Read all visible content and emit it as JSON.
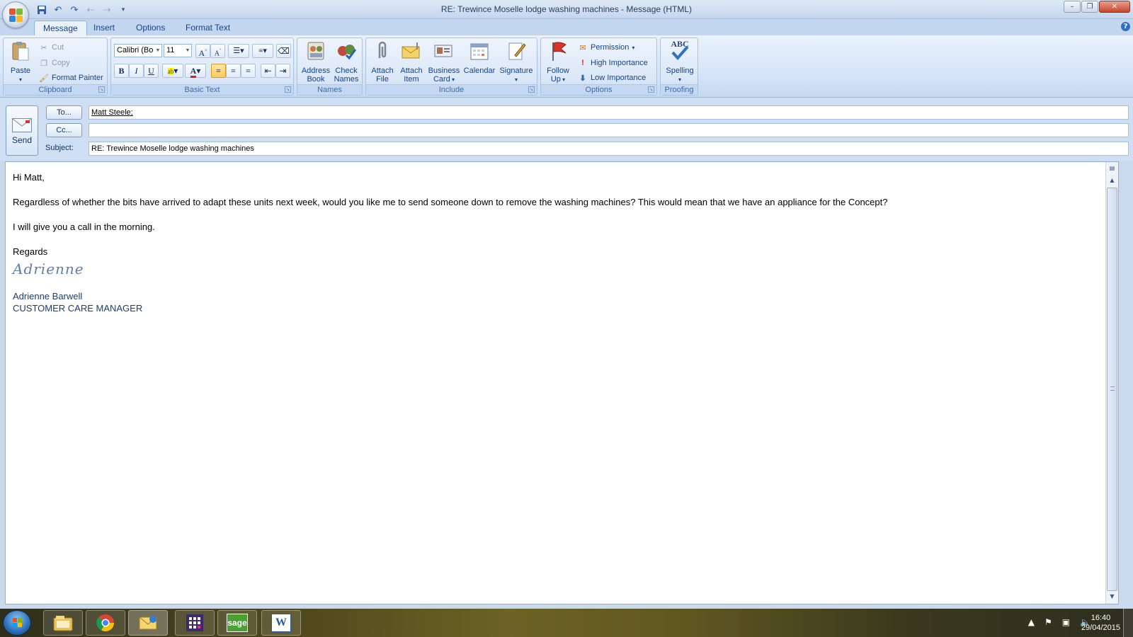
{
  "window": {
    "title": "RE: Trewince Moselle lodge washing machines - Message (HTML)",
    "controls": {
      "minimize": "–",
      "maximize": "❐",
      "close": "✕"
    }
  },
  "quick_access": {
    "items": [
      {
        "name": "save-icon",
        "glyph": "💾"
      },
      {
        "name": "undo-icon",
        "glyph": "↶"
      },
      {
        "name": "redo-icon",
        "glyph": "↷"
      },
      {
        "name": "up-icon",
        "glyph": "↑"
      },
      {
        "name": "down-icon",
        "glyph": "↓"
      },
      {
        "name": "customize-icon",
        "glyph": "▾"
      }
    ]
  },
  "tabs": [
    {
      "label": "Message",
      "active": true
    },
    {
      "label": "Insert",
      "active": false
    },
    {
      "label": "Options",
      "active": false
    },
    {
      "label": "Format Text",
      "active": false
    }
  ],
  "ribbon": {
    "clipboard": {
      "label": "Clipboard",
      "paste": "Paste",
      "cut": "Cut",
      "copy": "Copy",
      "format_painter": "Format Painter"
    },
    "basic_text": {
      "label": "Basic Text",
      "font_name": "Calibri (Bo",
      "font_size": "11",
      "bold": "B",
      "italic": "I",
      "underline": "U"
    },
    "names": {
      "label": "Names",
      "address_book_1": "Address",
      "address_book_2": "Book",
      "check_names_1": "Check",
      "check_names_2": "Names"
    },
    "include": {
      "label": "Include",
      "attach_file_1": "Attach",
      "attach_file_2": "File",
      "attach_item_1": "Attach",
      "attach_item_2": "Item",
      "business_card_1": "Business",
      "business_card_2": "Card",
      "calendar": "Calendar",
      "signature": "Signature"
    },
    "options": {
      "label": "Options",
      "follow_up_1": "Follow",
      "follow_up_2": "Up",
      "permission": "Permission",
      "high_importance": "High Importance",
      "low_importance": "Low Importance"
    },
    "proofing": {
      "label": "Proofing",
      "spelling": "Spelling",
      "abc": "ABC"
    }
  },
  "header": {
    "send": "Send",
    "to_button": "To...",
    "cc_button": "Cc...",
    "subject_label": "Subject:",
    "to_value": "Matt Steele;",
    "cc_value": "",
    "subject_value": "RE: Trewince Moselle lodge washing machines"
  },
  "message": {
    "greeting": "Hi Matt,",
    "paragraph1": "Regardless of whether the bits have arrived to adapt these units next week, would you like me to send someone down to remove the washing machines?  This would mean that we have an appliance for the Concept?",
    "paragraph2": "I will give you a call in the morning.",
    "closing": "Regards",
    "signature_script": "Adrienne",
    "sender_name": "Adrienne Barwell",
    "sender_title": "CUSTOMER CARE MANAGER"
  },
  "taskbar": {
    "items": [
      {
        "name": "explorer-icon"
      },
      {
        "name": "chrome-icon"
      },
      {
        "name": "outlook-icon"
      },
      {
        "name": "calculator-app-icon"
      },
      {
        "name": "sage-icon",
        "label": "sage"
      },
      {
        "name": "word-icon",
        "label": "W"
      }
    ],
    "time": "16:40",
    "date": "29/04/2015"
  },
  "colors": {
    "ribbon_text": "#15428b",
    "signature": "#1f3c6b",
    "close_button": "#c7442b"
  }
}
